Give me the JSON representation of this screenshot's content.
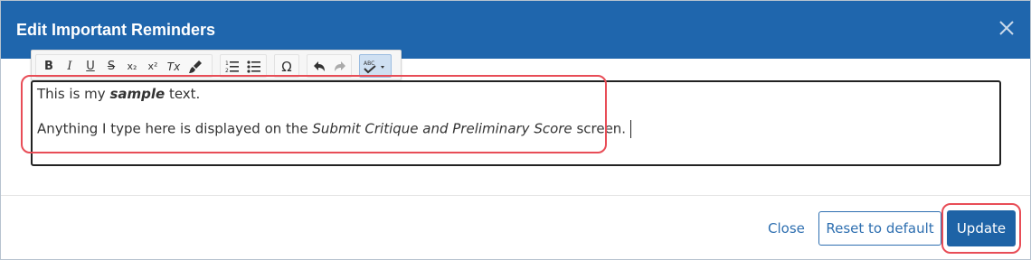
{
  "dialog": {
    "title": "Edit Important Reminders"
  },
  "toolbar": {
    "buttons": [
      {
        "name": "bold",
        "glyph": "B"
      },
      {
        "name": "italic",
        "glyph": "I"
      },
      {
        "name": "underline",
        "glyph": "U"
      },
      {
        "name": "strikethrough",
        "glyph": "S"
      },
      {
        "name": "subscript",
        "glyph": "x₂"
      },
      {
        "name": "superscript",
        "glyph": "x²"
      },
      {
        "name": "remove-format",
        "glyph": "Tx"
      },
      {
        "name": "copy-formatting",
        "glyph": "brush"
      },
      {
        "name": "numbered-list",
        "glyph": "ol"
      },
      {
        "name": "bulleted-list",
        "glyph": "ul"
      },
      {
        "name": "special-character",
        "glyph": "Ω"
      },
      {
        "name": "undo",
        "glyph": "undo"
      },
      {
        "name": "redo",
        "glyph": "redo"
      },
      {
        "name": "spell-check",
        "glyph": "ABC"
      }
    ]
  },
  "editor": {
    "line1": {
      "before": "This is my ",
      "emphasis": "sample",
      "after": " text."
    },
    "line2": {
      "before": "Anything I type here is displayed on the ",
      "emphasis": "Submit Critique and Preliminary Score",
      "after": " screen."
    }
  },
  "footer": {
    "close_label": "Close",
    "reset_label": "Reset to default",
    "update_label": "Update"
  },
  "colors": {
    "header_bg": "#1f66ad",
    "primary": "#1e63a6",
    "highlight": "#e84d57"
  }
}
